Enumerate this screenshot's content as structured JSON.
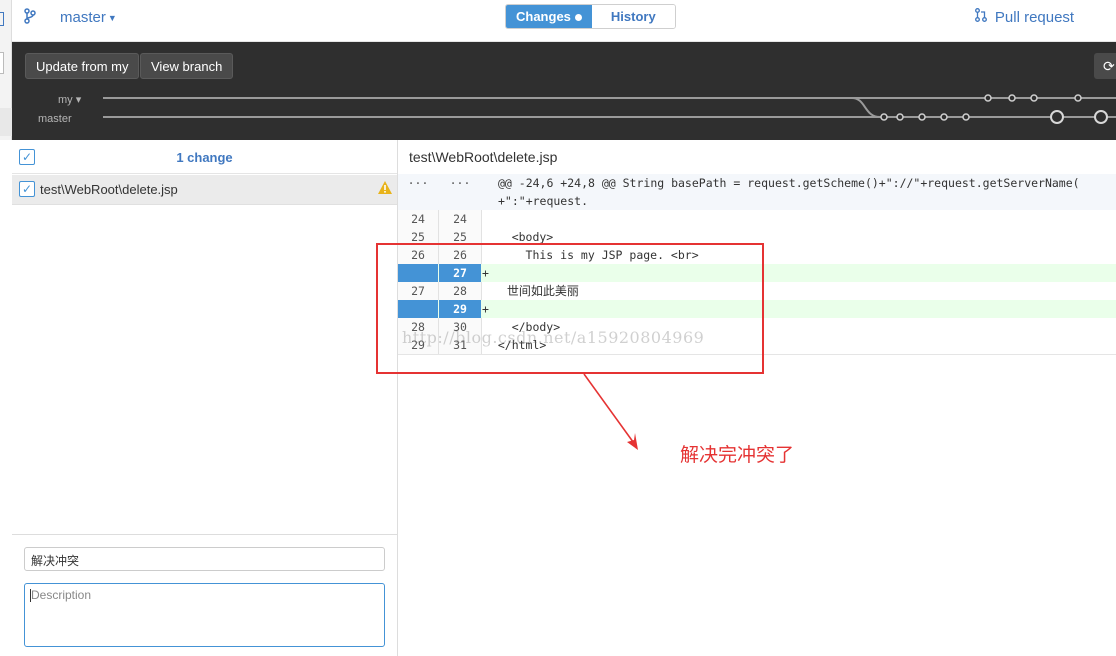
{
  "toolbar": {
    "branch_name": "master",
    "tabs": [
      {
        "label": "Changes",
        "active": true
      },
      {
        "label": "History",
        "active": false
      }
    ],
    "pull_request_label": "Pull request"
  },
  "branchbar": {
    "update_button": "Update from my",
    "view_branch_button": "View branch",
    "graph_labels": {
      "my": "my",
      "master": "master"
    }
  },
  "changes": {
    "count_label": "1 change",
    "files": [
      {
        "path_prefix": "test\\WebRoot\\",
        "filename": "delete.jsp",
        "warning": true
      }
    ]
  },
  "commit": {
    "summary_value": "解决冲突",
    "description_placeholder": "Description"
  },
  "diff": {
    "file_prefix": "test\\WebRoot\\",
    "file_name": "delete.jsp",
    "hunk_header": "@@ -24,6 +24,8 @@ String basePath = request.getScheme()+\"://\"+request.getServerName(\n+\":\"+request.",
    "lines": [
      {
        "old": "24",
        "new": "24",
        "text": ""
      },
      {
        "old": "25",
        "new": "25",
        "text": "    <body>"
      },
      {
        "old": "26",
        "new": "26",
        "text": "      This is my JSP page. <br>"
      },
      {
        "old": "",
        "new": "27",
        "text": "+",
        "added": true
      },
      {
        "old": "27",
        "new": "28",
        "text": "      世间如此美丽"
      },
      {
        "old": "",
        "new": "29",
        "text": "+",
        "added": true
      },
      {
        "old": "28",
        "new": "30",
        "text": "    </body>"
      },
      {
        "old": "29",
        "new": "31",
        "text": "  </html>"
      }
    ]
  },
  "annotations": {
    "watermark": "http://blog.csdn.net/a15920804969",
    "note": "解决完冲突了",
    "color": "#e53333"
  },
  "colors": {
    "accent": "#4493d6",
    "link": "#4078c0",
    "added_bg": "#eaffea",
    "dark_bar": "#2f2f2f"
  }
}
